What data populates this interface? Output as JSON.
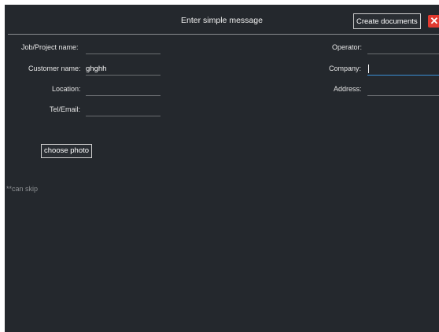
{
  "header": {
    "title": "Enter simple message",
    "create_documents_label": "Create documents",
    "close_glyph": "✕"
  },
  "left_fields": [
    {
      "label": "Job/Project name:",
      "value": ""
    },
    {
      "label": "Customer name:",
      "value": "ghghh"
    },
    {
      "label": "Location:",
      "value": ""
    },
    {
      "label": "Tel/Email:",
      "value": ""
    }
  ],
  "right_fields": [
    {
      "label": "Operator:",
      "value": ""
    },
    {
      "label": "Company:",
      "value": ""
    },
    {
      "label": "Address:",
      "value": ""
    }
  ],
  "choose_photo_label": "choose photo",
  "hint_text": "**can skip",
  "colors": {
    "background": "#24282d",
    "close_button": "#e23a30",
    "focus_underline": "#3a8fd6"
  },
  "icons": {
    "close": "close-icon"
  }
}
